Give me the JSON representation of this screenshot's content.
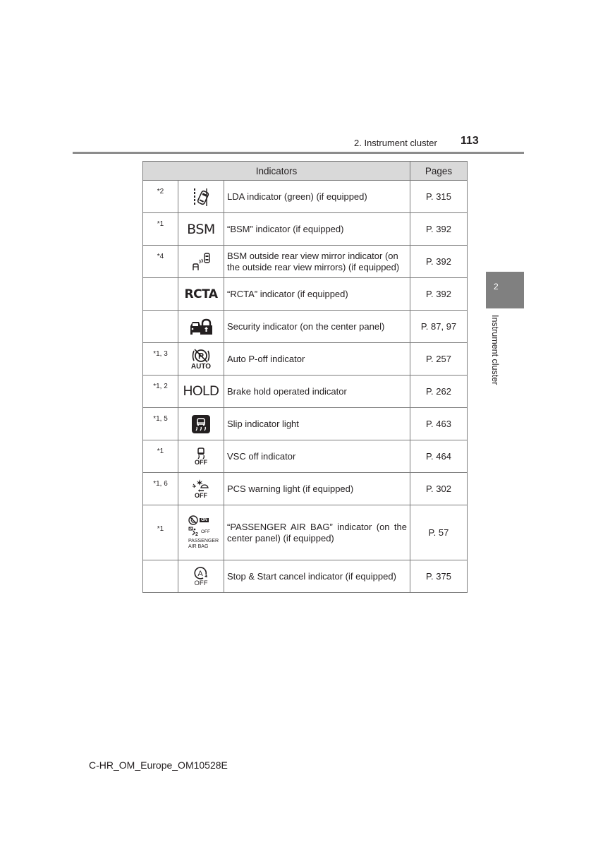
{
  "header": {
    "section": "2. Instrument cluster",
    "page_number": "113"
  },
  "side_tab": {
    "chapter_number": "2",
    "chapter_label": "Instrument cluster"
  },
  "table": {
    "headers": {
      "indicators": "Indicators",
      "pages": "Pages"
    },
    "rows": [
      {
        "note": "*2",
        "icon": "lda-icon",
        "description": "LDA indicator (green) (if equipped)",
        "page": "P. 315"
      },
      {
        "note": "*1",
        "icon": "bsm-text-icon",
        "icon_text": "BSM",
        "description": "“BSM” indicator (if equipped)",
        "page": "P. 392"
      },
      {
        "note": "*4",
        "icon": "bsm-mirror-icon",
        "description": "BSM outside rear view mirror indicator (on the outside rear view mirrors) (if equipped)",
        "page": "P. 392"
      },
      {
        "note": "",
        "icon": "rcta-text-icon",
        "icon_text": "RCTA",
        "description": "“RCTA” indicator (if equipped)",
        "page": "P. 392"
      },
      {
        "note": "",
        "icon": "security-icon",
        "description": "Security indicator (on the center panel)",
        "page": "P. 87, 97"
      },
      {
        "note": "*1, 3",
        "icon": "auto-p-off-icon",
        "icon_text": "AUTO",
        "description": "Auto P-off indicator",
        "page": "P. 257"
      },
      {
        "note": "*1, 2",
        "icon": "hold-text-icon",
        "icon_text": "HOLD",
        "description": "Brake hold operated indicator",
        "page": "P. 262"
      },
      {
        "note": "*1, 5",
        "icon": "slip-indicator-icon",
        "description": "Slip indicator light",
        "page": "P. 463"
      },
      {
        "note": "*1",
        "icon": "vsc-off-icon",
        "icon_text": "OFF",
        "description": "VSC off indicator",
        "page": "P. 464"
      },
      {
        "note": "*1, 6",
        "icon": "pcs-warning-icon",
        "icon_text": "OFF",
        "description": "PCS warning light (if equipped)",
        "page": "P. 302"
      },
      {
        "note": "*1",
        "icon": "passenger-airbag-icon",
        "icon_text_on": "ON",
        "icon_text_off": "OFF",
        "icon_text_label": "PASSENGER AIR BAG",
        "description": "“PASSENGER AIR BAG” indicator (on the center panel) (if equipped)",
        "page": "P. 57"
      },
      {
        "note": "",
        "icon": "stop-start-cancel-icon",
        "icon_text": "OFF",
        "description": "Stop & Start cancel indicator (if equipped)",
        "page": "P. 375"
      }
    ]
  },
  "footer": {
    "document_code": "C-HR_OM_Europe_OM10528E"
  }
}
